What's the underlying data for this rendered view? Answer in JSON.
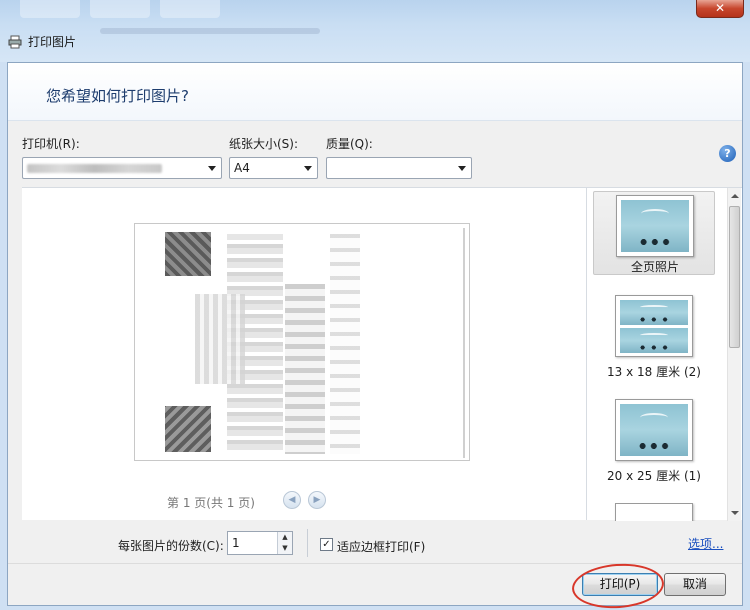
{
  "window": {
    "title": "打印图片",
    "close_glyph": "✕"
  },
  "header": {
    "question": "您希望如何打印图片?"
  },
  "printer": {
    "label": "打印机(R):"
  },
  "paper_size": {
    "label": "纸张大小(S):",
    "value": "A4"
  },
  "quality": {
    "label": "质量(Q):",
    "value": ""
  },
  "help": {
    "glyph": "?"
  },
  "preview": {
    "page_indicator": "第 1 页(共 1 页)",
    "prev_glyph": "◀",
    "next_glyph": "▶"
  },
  "layouts": [
    {
      "label": "全页照片",
      "selected": true
    },
    {
      "label": "13 x 18 厘米 (2)",
      "selected": false
    },
    {
      "label": "20 x 25 厘米 (1)",
      "selected": false
    }
  ],
  "options": {
    "copies_label": "每张图片的份数(C):",
    "copies_value": "1",
    "spin_up": "▲",
    "spin_down": "▼",
    "fit_label": "适应边框打印(F)",
    "fit_checked_glyph": "✓",
    "options_link": "选项..."
  },
  "buttons": {
    "print": "打印(P)",
    "cancel": "取消"
  },
  "colors": {
    "accent_link": "#1a4fbf",
    "annotation_circle": "#d8372a"
  }
}
